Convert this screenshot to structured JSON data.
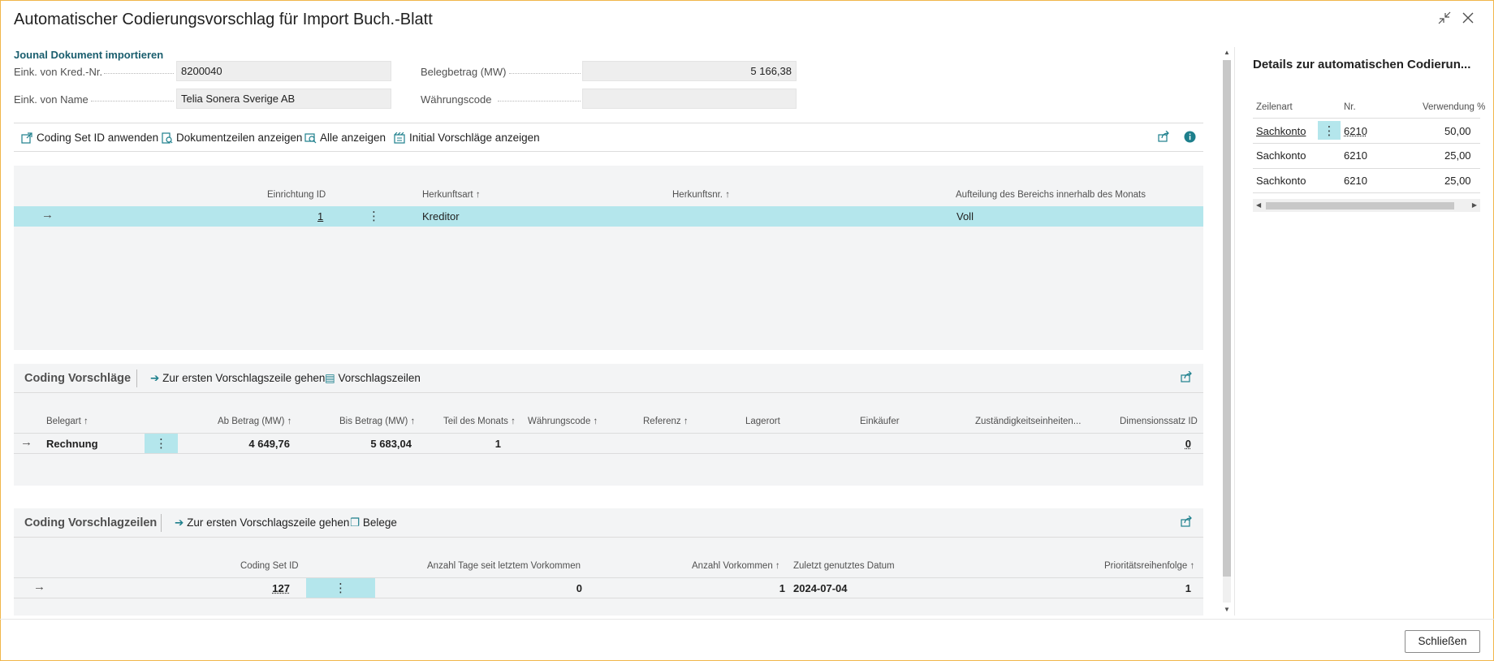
{
  "window": {
    "title": "Automatischer Codierungsvorschlag für Import Buch.-Blatt",
    "collapse_icon": "collapse-icon",
    "close_icon": "close-icon"
  },
  "header": {
    "section_title": "Jounal Dokument importieren",
    "fields": {
      "vendor_no_label": "Eink. von Kred.-Nr.",
      "vendor_no_value": "8200040",
      "vendor_name_label": "Eink. von Name",
      "vendor_name_value": "Telia Sonera Sverige AB",
      "amount_label": "Belegbetrag (MW)",
      "amount_value": "5 166,38",
      "currency_label": "Währungscode",
      "currency_value": ""
    }
  },
  "toolbar": {
    "actions": [
      {
        "label": "Coding Set ID anwenden",
        "icon": "apply-icon"
      },
      {
        "label": "Dokumentzeilen anzeigen",
        "icon": "document-lines-icon"
      },
      {
        "label": "Alle anzeigen",
        "icon": "show-all-icon"
      },
      {
        "label": "Initial Vorschläge anzeigen",
        "icon": "initial-suggestions-icon"
      }
    ],
    "share_icon": "share-icon",
    "info_icon": "info-icon"
  },
  "setup_list": {
    "columns": [
      "Einrichtung ID",
      "Herkunftsart",
      "Herkunftsnr.",
      "Aufteilung des Bereichs innerhalb des Monats"
    ],
    "rows": [
      {
        "einrichtung_id": "1",
        "herkunftsart": "Kreditor",
        "herkunftsnr": "",
        "aufteilung": "Voll"
      }
    ]
  },
  "coding_vorschlaege": {
    "title": "Coding Vorschläge",
    "actions": [
      "Zur ersten Vorschlagszeile gehen",
      "Vorschlagszeilen"
    ],
    "columns": [
      "Belegart",
      "Ab Betrag (MW)",
      "Bis Betrag (MW)",
      "Teil des Monats",
      "Währungscode",
      "Referenz",
      "Lagerort",
      "Einkäufer",
      "Zuständigkeitseinheiten...",
      "Dimensionssatz ID"
    ],
    "rows": [
      {
        "belegart": "Rechnung",
        "ab_betrag": "4 649,76",
        "bis_betrag": "5 683,04",
        "teil_des_monats": "1",
        "waehrungscode": "",
        "referenz": "",
        "lagerort": "",
        "einkaeufer": "",
        "zustaendigkeit": "",
        "dimensionssatz_id": "0"
      }
    ]
  },
  "coding_vorschlagzeilen": {
    "title": "Coding Vorschlagzeilen",
    "actions": [
      "Zur ersten Vorschlagszeile gehen",
      "Belege"
    ],
    "columns": [
      "Coding Set ID",
      "Anzahl Tage seit letztem Vorkommen",
      "Anzahl Vorkommen",
      "Zuletzt genutztes Datum",
      "Prioritätsreihenfolge"
    ],
    "rows": [
      {
        "coding_set_id": "127",
        "anzahl_tage": "0",
        "anzahl_vorkommen": "1",
        "zuletzt_datum": "2024-07-04",
        "prioritaet": "1"
      }
    ]
  },
  "details_pane": {
    "title": "Details zur automatischen Codierun...",
    "columns": [
      "Zeilenart",
      "Nr.",
      "Verwendung %"
    ],
    "rows": [
      {
        "zeilenart": "Sachkonto",
        "nr": "6210",
        "verwendung": "50,00"
      },
      {
        "zeilenart": "Sachkonto",
        "nr": "6210",
        "verwendung": "25,00"
      },
      {
        "zeilenart": "Sachkonto",
        "nr": "6210",
        "verwendung": "25,00"
      }
    ]
  },
  "footer": {
    "close_label": "Schließen"
  },
  "colors": {
    "accent": "#1d7f8c",
    "selection": "#b4e6ec",
    "window_border": "#f0b64a"
  }
}
